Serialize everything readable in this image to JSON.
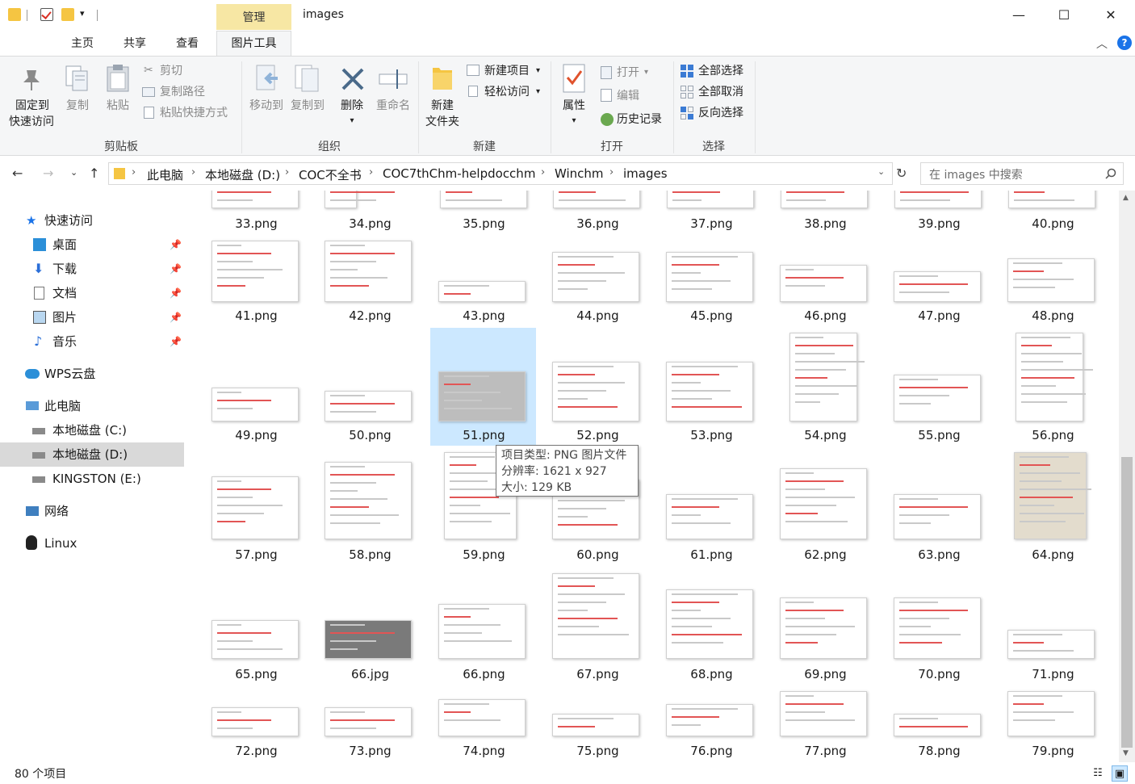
{
  "window": {
    "title": "images",
    "manage_tab": "管理",
    "minimize": "—",
    "maximize": "☐",
    "close": "✕"
  },
  "tabs": {
    "home": "主页",
    "share": "共享",
    "view": "查看",
    "picture_tools": "图片工具"
  },
  "ribbon": {
    "clipboard": {
      "label": "剪贴板",
      "pin": "固定到\n快速访问",
      "pin1": "固定到",
      "pin2": "快速访问",
      "copy": "复制",
      "paste": "粘贴",
      "cut": "剪切",
      "copy_path": "复制路径",
      "paste_shortcut": "粘贴快捷方式"
    },
    "organize": {
      "label": "组织",
      "move_to": "移动到",
      "copy_to": "复制到",
      "delete": "删除",
      "rename": "重命名"
    },
    "new": {
      "label": "新建",
      "new_folder1": "新建",
      "new_folder2": "文件夹",
      "new_item": "新建项目",
      "easy_access": "轻松访问"
    },
    "open": {
      "label": "打开",
      "properties": "属性",
      "open": "打开",
      "edit": "编辑",
      "history": "历史记录"
    },
    "select": {
      "label": "选择",
      "select_all": "全部选择",
      "select_none": "全部取消",
      "invert": "反向选择"
    }
  },
  "address": {
    "crumbs": [
      "此电脑",
      "本地磁盘 (D:)",
      "COC不全书",
      "COC7thChm-helpdocchm",
      "Winchm",
      "images"
    ],
    "search_placeholder": "在 images 中搜索"
  },
  "nav": {
    "quick_access": "快速访问",
    "desktop": "桌面",
    "downloads": "下载",
    "documents": "文档",
    "pictures": "图片",
    "music": "音乐",
    "wps": "WPS云盘",
    "this_pc": "此电脑",
    "drive_c": "本地磁盘 (C:)",
    "drive_d": "本地磁盘 (D:)",
    "drive_e": "KINGSTON (E:)",
    "network": "网络",
    "linux": "Linux"
  },
  "files": [
    [
      "33.png",
      "34.png",
      "35.png",
      "36.png",
      "37.png",
      "38.png",
      "39.png",
      "40.png"
    ],
    [
      "41.png",
      "42.png",
      "43.png",
      "44.png",
      "45.png",
      "46.png",
      "47.png",
      "48.png"
    ],
    [
      "49.png",
      "50.png",
      "51.png",
      "52.png",
      "53.png",
      "54.png",
      "55.png",
      "56.png"
    ],
    [
      "57.png",
      "58.png",
      "59.png",
      "60.png",
      "61.png",
      "62.png",
      "63.png",
      "64.png"
    ],
    [
      "65.png",
      "66.jpg",
      "66.png",
      "67.png",
      "68.png",
      "69.png",
      "70.png",
      "71.png"
    ],
    [
      "72.png",
      "73.png",
      "74.png",
      "75.png",
      "76.png",
      "77.png",
      "78.png",
      "79.png"
    ]
  ],
  "tooltip": {
    "type": "项目类型: PNG 图片文件",
    "resolution": "分辨率: 1621 x 927",
    "size": "大小: 129 KB"
  },
  "status": {
    "count": "80 个项目"
  },
  "colors": {
    "accent": "#1a73e8",
    "selection": "#cce8ff",
    "manage_tab": "#f7e7a4",
    "folder": "#f5c542"
  }
}
